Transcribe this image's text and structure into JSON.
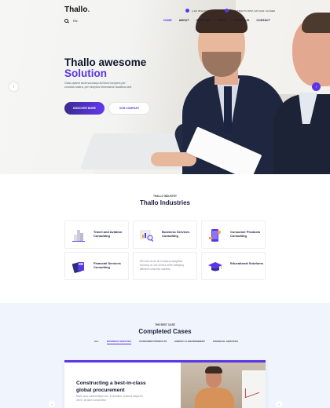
{
  "brand": {
    "name": "Thallo",
    "dot": "."
  },
  "topbar": {
    "phone": "(+91) 0512-0000-0000 (24/7)",
    "email": "FROM 8AM TO 6PM, SAT-SUN: CLOSED"
  },
  "util": {
    "lang": "EN"
  },
  "nav": {
    "items": [
      "HOME",
      "ABOUT",
      "SERVICES",
      "NEWS",
      "PORTFOLIO",
      "CONTACT"
    ]
  },
  "hero": {
    "title_line1": "Thallo awesome",
    "title_line2": "Solution",
    "description": "Class aptent taciti sociosqu ad litora torquent per conubia nostra, per inceptos himenaeos faucibus sed.",
    "primary_button": "DISCOVER MORE",
    "secondary_button": "OUR COMPANY"
  },
  "industries": {
    "eyebrow": "THALLO INDUSTRY",
    "title": "Thallo Industries",
    "cards": [
      {
        "label": "Travel and Aviation Consulting",
        "icon": "building-icon"
      },
      {
        "label": "Business Services Consulting",
        "icon": "magnifier-chart-icon"
      },
      {
        "label": "Consumer Products Consulting",
        "icon": "mobile-shopping-icon"
      },
      {
        "label": "Financial Services Consulting",
        "icon": "calculator-icon"
      },
      {
        "label": "Educational Solutions",
        "icon": "graduation-cap-icon"
      }
    ],
    "text_card": "We work as an all in ways propagation, focusing on one service while satisfying different consumer markets."
  },
  "cases": {
    "eyebrow": "THE BEST CASE",
    "title": "Completed Cases",
    "filters": [
      "ALL",
      "BUSINESS SERVICES",
      "CONSUMER PRODUCTS",
      "ENERGY & ENVIRONMENT",
      "FINANCIAL SERVICES"
    ],
    "feature_title": "Constructing a best-in-class global procurement",
    "feature_desc": "Morbi arcu nulla tristique non, in tincidunt, vivamus aliquet in lorem, sit amet consectetur."
  },
  "colors": {
    "accent": "#5a36e6",
    "dark": "#1b1d3b"
  }
}
